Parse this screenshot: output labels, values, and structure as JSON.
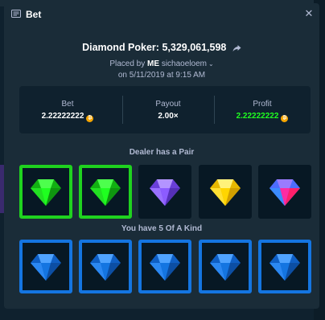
{
  "modal": {
    "title": "Bet",
    "close_icon": "close-icon"
  },
  "bet": {
    "game": "Diamond Poker",
    "bet_id": "5,329,061,598",
    "placed_by_prefix": "Placed by",
    "user": "ME",
    "username": "sichaoeloem",
    "date": "on 5/11/2019 at 9:15 AM"
  },
  "stats": {
    "bet_label": "Bet",
    "bet_value": "2.22222222",
    "payout_label": "Payout",
    "payout_value": "2.00×",
    "profit_label": "Profit",
    "profit_value": "2.22222222",
    "currency_icon": "bitcoin-coin-icon"
  },
  "dealer": {
    "label": "Dealer has a Pair",
    "gems": [
      {
        "gem": "green-diamond-icon",
        "highlighted": true,
        "color": "#1fff20"
      },
      {
        "gem": "green-diamond-icon",
        "highlighted": true,
        "color": "#1fff20"
      },
      {
        "gem": "purple-diamond-icon",
        "highlighted": false,
        "color": "#8c5cff"
      },
      {
        "gem": "yellow-diamond-icon",
        "highlighted": false,
        "color": "#ffd500"
      },
      {
        "gem": "multicolor-diamond-icon",
        "highlighted": false,
        "color": "#ff2ba3"
      }
    ]
  },
  "player": {
    "label": "You have 5 Of A Kind",
    "gems": [
      {
        "gem": "blue-diamond-icon",
        "highlighted": true,
        "color": "#1475e1"
      },
      {
        "gem": "blue-diamond-icon",
        "highlighted": true,
        "color": "#1475e1"
      },
      {
        "gem": "blue-diamond-icon",
        "highlighted": true,
        "color": "#1475e1"
      },
      {
        "gem": "blue-diamond-icon",
        "highlighted": true,
        "color": "#1475e1"
      },
      {
        "gem": "blue-diamond-icon",
        "highlighted": true,
        "color": "#1475e1"
      }
    ]
  },
  "colors": {
    "background": "#0f212e",
    "panel": "#1a2c38",
    "profit_green": "#1fff20",
    "highlight_green": "#1fd21f",
    "highlight_blue": "#1475e1"
  }
}
